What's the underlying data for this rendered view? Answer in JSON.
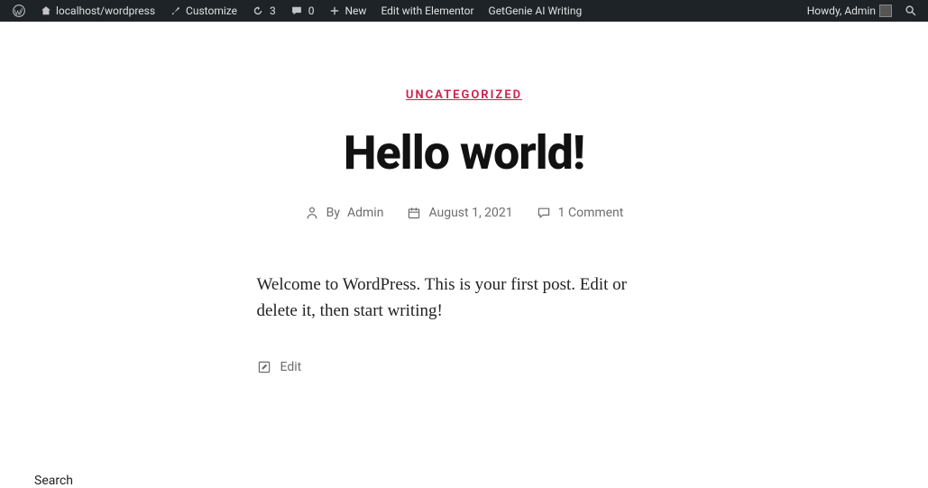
{
  "adminbar": {
    "site": "localhost/wordpress",
    "customize": "Customize",
    "updates": "3",
    "comments": "0",
    "new": "New",
    "elementor": "Edit with Elementor",
    "getgenie": "GetGenie AI Writing",
    "howdy": "Howdy, Admin"
  },
  "post": {
    "category": "UNCATEGORIZED",
    "title": "Hello world!",
    "by_label": "By",
    "author": "Admin",
    "date": "August 1, 2021",
    "comment_count": "1 Comment",
    "content": "Welcome to WordPress. This is your first post. Edit or delete it, then start writing!",
    "edit_label": "Edit"
  },
  "footer": {
    "search_label": "Search"
  }
}
